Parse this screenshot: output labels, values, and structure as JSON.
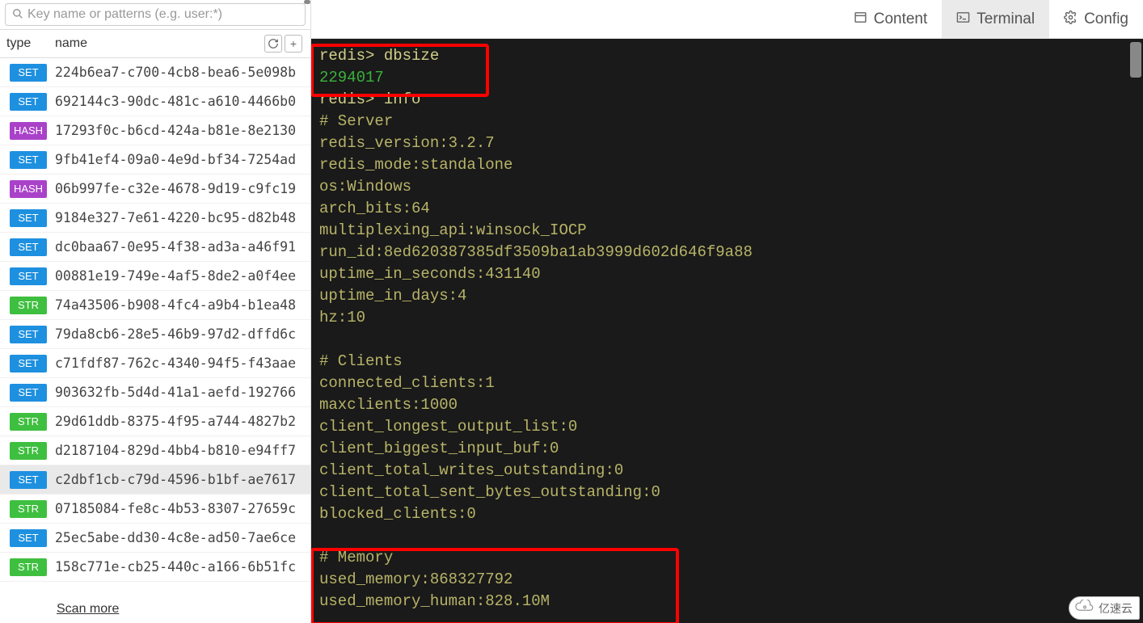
{
  "search": {
    "placeholder": "Key name or patterns (e.g. user:*)"
  },
  "columns": {
    "type": "type",
    "name": "name"
  },
  "type_labels": {
    "SET": "SET",
    "HASH": "HASH",
    "STR": "STR"
  },
  "keys": [
    {
      "type": "SET",
      "name": "224b6ea7-c700-4cb8-bea6-5e098b"
    },
    {
      "type": "SET",
      "name": "692144c3-90dc-481c-a610-4466b0"
    },
    {
      "type": "HASH",
      "name": "17293f0c-b6cd-424a-b81e-8e2130"
    },
    {
      "type": "SET",
      "name": "9fb41ef4-09a0-4e9d-bf34-7254ad"
    },
    {
      "type": "HASH",
      "name": "06b997fe-c32e-4678-9d19-c9fc19"
    },
    {
      "type": "SET",
      "name": "9184e327-7e61-4220-bc95-d82b48"
    },
    {
      "type": "SET",
      "name": "dc0baa67-0e95-4f38-ad3a-a46f91"
    },
    {
      "type": "SET",
      "name": "00881e19-749e-4af5-8de2-a0f4ee"
    },
    {
      "type": "STR",
      "name": "74a43506-b908-4fc4-a9b4-b1ea48"
    },
    {
      "type": "SET",
      "name": "79da8cb6-28e5-46b9-97d2-dffd6c"
    },
    {
      "type": "SET",
      "name": "c71fdf87-762c-4340-94f5-f43aae"
    },
    {
      "type": "SET",
      "name": "903632fb-5d4d-41a1-aefd-192766"
    },
    {
      "type": "STR",
      "name": "29d61ddb-8375-4f95-a744-4827b2"
    },
    {
      "type": "STR",
      "name": "d2187104-829d-4bb4-b810-e94ff7"
    },
    {
      "type": "SET",
      "name": "c2dbf1cb-c79d-4596-b1bf-ae7617",
      "selected": true
    },
    {
      "type": "STR",
      "name": "07185084-fe8c-4b53-8307-27659c"
    },
    {
      "type": "SET",
      "name": "25ec5abe-dd30-4c8e-ad50-7ae6ce"
    },
    {
      "type": "STR",
      "name": "158c771e-cb25-440c-a166-6b51fc"
    }
  ],
  "scan_more": "Scan more",
  "tabs": {
    "content": "Content",
    "terminal": "Terminal",
    "config": "Config"
  },
  "terminal": {
    "prompt": "redis>",
    "cmd1": "dbsize",
    "res1": "2294017",
    "cmd2": "info",
    "lines": [
      "# Server",
      "redis_version:3.2.7",
      "redis_mode:standalone",
      "os:Windows",
      "arch_bits:64",
      "multiplexing_api:winsock_IOCP",
      "run_id:8ed620387385df3509ba1ab3999d602d646f9a88",
      "uptime_in_seconds:431140",
      "uptime_in_days:4",
      "hz:10",
      "",
      "# Clients",
      "connected_clients:1",
      "maxclients:1000",
      "client_longest_output_list:0",
      "client_biggest_input_buf:0",
      "client_total_writes_outstanding:0",
      "client_total_sent_bytes_outstanding:0",
      "blocked_clients:0",
      "",
      "# Memory",
      "used_memory:868327792",
      "used_memory_human:828.10M"
    ]
  },
  "watermark": "亿速云"
}
